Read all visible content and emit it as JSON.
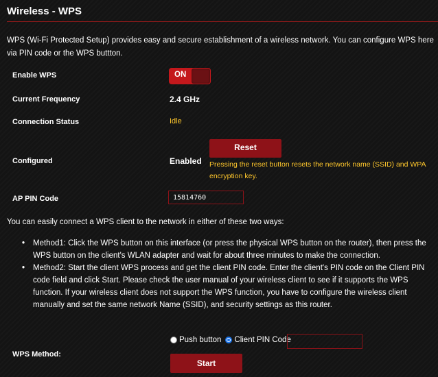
{
  "page": {
    "title": "Wireless - WPS",
    "intro": "WPS (Wi-Fi Protected Setup) provides easy and secure establishment of a wireless network. You can configure WPS here via PIN code or the WPS buttton."
  },
  "settings": {
    "enable_wps": {
      "label": "Enable WPS",
      "toggle_text": "ON"
    },
    "current_frequency": {
      "label": "Current Frequency",
      "value": "2.4 GHz"
    },
    "connection_status": {
      "label": "Connection Status",
      "value": "Idle"
    },
    "configured": {
      "label": "Configured",
      "value": "Enabled",
      "reset_button": "Reset",
      "reset_note": "Pressing the reset button resets the network name (SSID) and WPA encryption key."
    },
    "ap_pin": {
      "label": "AP PIN Code",
      "value": "15814760"
    }
  },
  "connect": {
    "intro": "You can easily connect a WPS client to the network in either of these two ways:",
    "methods": [
      "Method1: Click the WPS button on this interface (or press the physical WPS button on the router), then press the WPS button on the client's WLAN adapter and wait for about three minutes to make the connection.",
      "Method2: Start the client WPS process and get the client PIN code. Enter the client's PIN code on the Client PIN code field and click Start. Please check the user manual of your wireless client to see if it supports the WPS function. If your wireless client does not support the WPS function, you have to configure the wireless client manually and set the same network Name (SSID), and security settings as this router."
    ]
  },
  "wps_method": {
    "label": "WPS Method:",
    "options": [
      "Push button",
      "Client PIN Code"
    ],
    "selected": "Client PIN Code",
    "client_pin_value": "",
    "start_button": "Start"
  },
  "colors": {
    "accent_red": "#8e1218",
    "toggle_red": "#c4181c",
    "status_yellow": "#ffc72c",
    "background": "#141414"
  }
}
